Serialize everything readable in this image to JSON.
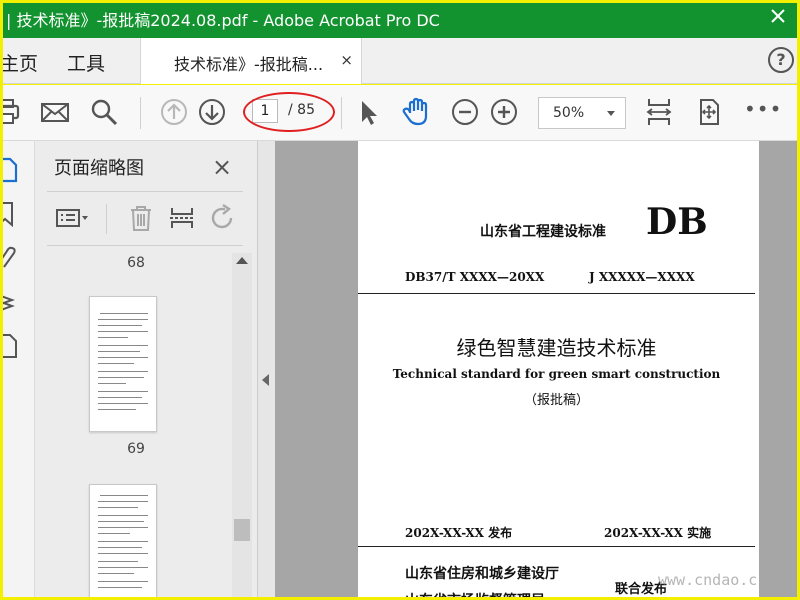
{
  "window": {
    "title": "| 技术标准》-报批稿2024.08.pdf - Adobe Acrobat Pro DC"
  },
  "menu": {
    "home": "主页",
    "tools": "工具"
  },
  "tab": {
    "label": "技术标准》-报批稿...",
    "close": "×"
  },
  "help": "?",
  "toolbar": {
    "current_page": "1",
    "total_pages": "/ 85",
    "zoom": "50%",
    "more": "•••"
  },
  "thumbnails": {
    "title": "页面缩略图",
    "close": "×",
    "items": [
      {
        "label": "68"
      },
      {
        "label": "69"
      }
    ]
  },
  "document": {
    "issuer": "山东省工程建设标准",
    "db": "DB",
    "code": "DB37/T XXXX—20XX",
    "record": "J XXXXX—XXXX",
    "title_cn": "绿色智慧建造技术标准",
    "title_en": "Technical standard for green smart construction",
    "status": "（报批稿）",
    "publish_date": "202X-XX-XX 发布",
    "effective_date": "202X-XX-XX 实施",
    "dept1": "山东省住房和城乡建设厅",
    "joint": "联合发布",
    "dept2": "山东省市场监督管理局"
  },
  "watermark": "www.cndao.c",
  "colors": {
    "titlebar": "#12932f",
    "frame": "#f2f000",
    "annotation": "#e02020",
    "hand_tool": "#1a6fd0"
  },
  "icons": {
    "toolbar": [
      "print-icon",
      "email-icon",
      "search-icon",
      "page-up-icon",
      "page-down-icon",
      "select-arrow-icon",
      "hand-icon",
      "zoom-out-icon",
      "zoom-in-icon",
      "fit-width-icon",
      "fit-page-icon"
    ],
    "rail": [
      "thumbnail-icon",
      "bookmark-icon",
      "attachment-icon",
      "layers-icon",
      "document-icon"
    ],
    "thumbnail_tools": [
      "options-icon",
      "delete-icon",
      "extract-icon",
      "rotate-icon"
    ]
  }
}
